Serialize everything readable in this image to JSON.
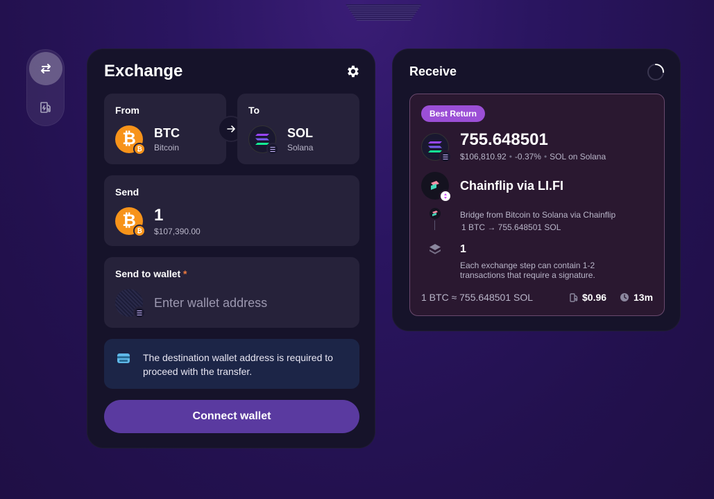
{
  "exchange": {
    "title": "Exchange",
    "from": {
      "label": "From",
      "symbol": "BTC",
      "name": "Bitcoin",
      "badge": "₿",
      "icon": "bitcoin-icon"
    },
    "to": {
      "label": "To",
      "symbol": "SOL",
      "name": "Solana",
      "icon": "solana-icon"
    },
    "send": {
      "label": "Send",
      "amount": "1",
      "usd": "$107,390.00"
    },
    "wallet": {
      "label": "Send to wallet",
      "required_mark": "*",
      "placeholder": "Enter wallet address"
    },
    "notice": {
      "text": "The destination wallet address is required to proceed with the transfer."
    },
    "connect_label": "Connect wallet"
  },
  "receive": {
    "title": "Receive",
    "badge": "Best Return",
    "amount": "755.648501",
    "usd": "$106,810.92",
    "change": "-0.37%",
    "chain": "SOL on Solana",
    "provider": "Chainflip via LI.FI",
    "step_desc": "Bridge from Bitcoin to Solana via Chainflip",
    "step_amounts": "1 BTC → 755.648501 SOL",
    "steps_count": "1",
    "steps_text": "Each exchange step can contain 1-2 transactions that require a signature.",
    "rate": "1 BTC ≈ 755.648501 SOL",
    "gas": "$0.96",
    "time": "13m"
  },
  "colors": {
    "accent": "#5a3aa0",
    "best_badge": "#9b4fd6",
    "btc": "#f7931a",
    "required": "#f07b3f"
  }
}
